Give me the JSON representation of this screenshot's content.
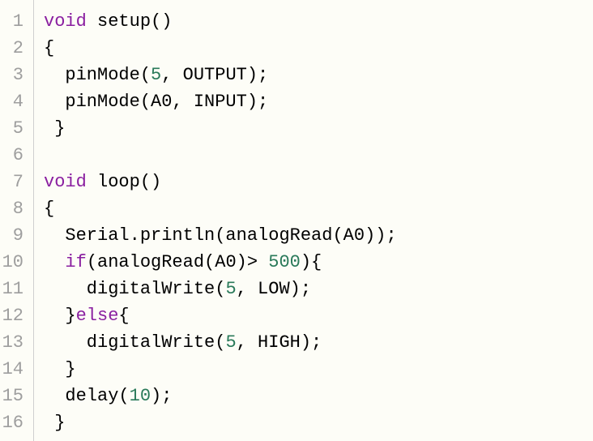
{
  "code": {
    "lines": [
      {
        "n": "1",
        "tokens": [
          {
            "t": "kw",
            "v": "void"
          },
          {
            "t": "",
            "v": " setup()"
          }
        ]
      },
      {
        "n": "2",
        "tokens": [
          {
            "t": "",
            "v": "{"
          }
        ]
      },
      {
        "n": "3",
        "tokens": [
          {
            "t": "",
            "v": "  pinMode("
          },
          {
            "t": "num",
            "v": "5"
          },
          {
            "t": "",
            "v": ", OUTPUT);"
          }
        ]
      },
      {
        "n": "4",
        "tokens": [
          {
            "t": "",
            "v": "  pinMode(A0, INPUT);"
          }
        ]
      },
      {
        "n": "5",
        "tokens": [
          {
            "t": "",
            "v": " }"
          }
        ]
      },
      {
        "n": "6",
        "tokens": [
          {
            "t": "",
            "v": ""
          }
        ]
      },
      {
        "n": "7",
        "tokens": [
          {
            "t": "kw",
            "v": "void"
          },
          {
            "t": "",
            "v": " loop()"
          }
        ]
      },
      {
        "n": "8",
        "tokens": [
          {
            "t": "",
            "v": "{"
          }
        ]
      },
      {
        "n": "9",
        "tokens": [
          {
            "t": "",
            "v": "  Serial.println(analogRead(A0));"
          }
        ]
      },
      {
        "n": "10",
        "tokens": [
          {
            "t": "",
            "v": "  "
          },
          {
            "t": "kw",
            "v": "if"
          },
          {
            "t": "",
            "v": "(analogRead(A0)> "
          },
          {
            "t": "num",
            "v": "500"
          },
          {
            "t": "",
            "v": "){"
          }
        ]
      },
      {
        "n": "11",
        "tokens": [
          {
            "t": "",
            "v": "    digitalWrite("
          },
          {
            "t": "num",
            "v": "5"
          },
          {
            "t": "",
            "v": ", LOW);"
          }
        ]
      },
      {
        "n": "12",
        "tokens": [
          {
            "t": "",
            "v": "  }"
          },
          {
            "t": "kw",
            "v": "else"
          },
          {
            "t": "",
            "v": "{"
          }
        ]
      },
      {
        "n": "13",
        "tokens": [
          {
            "t": "",
            "v": "    digitalWrite("
          },
          {
            "t": "num",
            "v": "5"
          },
          {
            "t": "",
            "v": ", HIGH);"
          }
        ]
      },
      {
        "n": "14",
        "tokens": [
          {
            "t": "",
            "v": "  }"
          }
        ]
      },
      {
        "n": "15",
        "tokens": [
          {
            "t": "",
            "v": "  delay("
          },
          {
            "t": "num",
            "v": "10"
          },
          {
            "t": "",
            "v": ");"
          }
        ]
      },
      {
        "n": "16",
        "tokens": [
          {
            "t": "",
            "v": " }"
          }
        ]
      }
    ]
  }
}
